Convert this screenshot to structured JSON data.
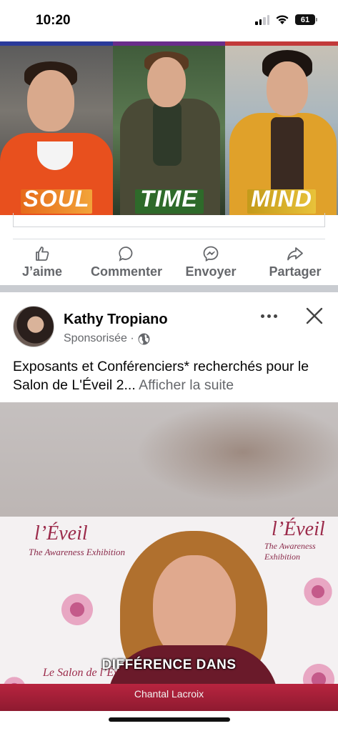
{
  "status_bar": {
    "time": "10:20",
    "battery": "61"
  },
  "collage": {
    "panels": [
      {
        "label": "SOUL",
        "accent": "#e8501e"
      },
      {
        "label": "TIME",
        "accent": "#2e6a2a"
      },
      {
        "label": "MIND",
        "accent": "#e0a12a"
      }
    ]
  },
  "actions": {
    "like": "J’aime",
    "comment": "Commenter",
    "send": "Envoyer",
    "share": "Partager"
  },
  "post": {
    "author": "Kathy Tropiano",
    "sponsored": "Sponsorisée ·",
    "text": "Exposants et Conférenciers* recherchés pour le Salon de L'Éveil 2...",
    "see_more": "Afficher la suite"
  },
  "video": {
    "brand_title": "l’Éveil",
    "brand_subtitle": "The Awareness Exhibition",
    "brand_small": "Le Salon de l’Éveil",
    "caption": "DIFFÉRENCE DANS",
    "speaker": "Chantal Lacroix",
    "accent": "#b8243f"
  },
  "icons": {
    "like": "thumbs-up-icon",
    "comment": "comment-bubble-icon",
    "send": "messenger-icon",
    "share": "share-arrow-icon",
    "globe": "globe-icon",
    "more": "more-dots-icon",
    "close": "close-icon"
  }
}
